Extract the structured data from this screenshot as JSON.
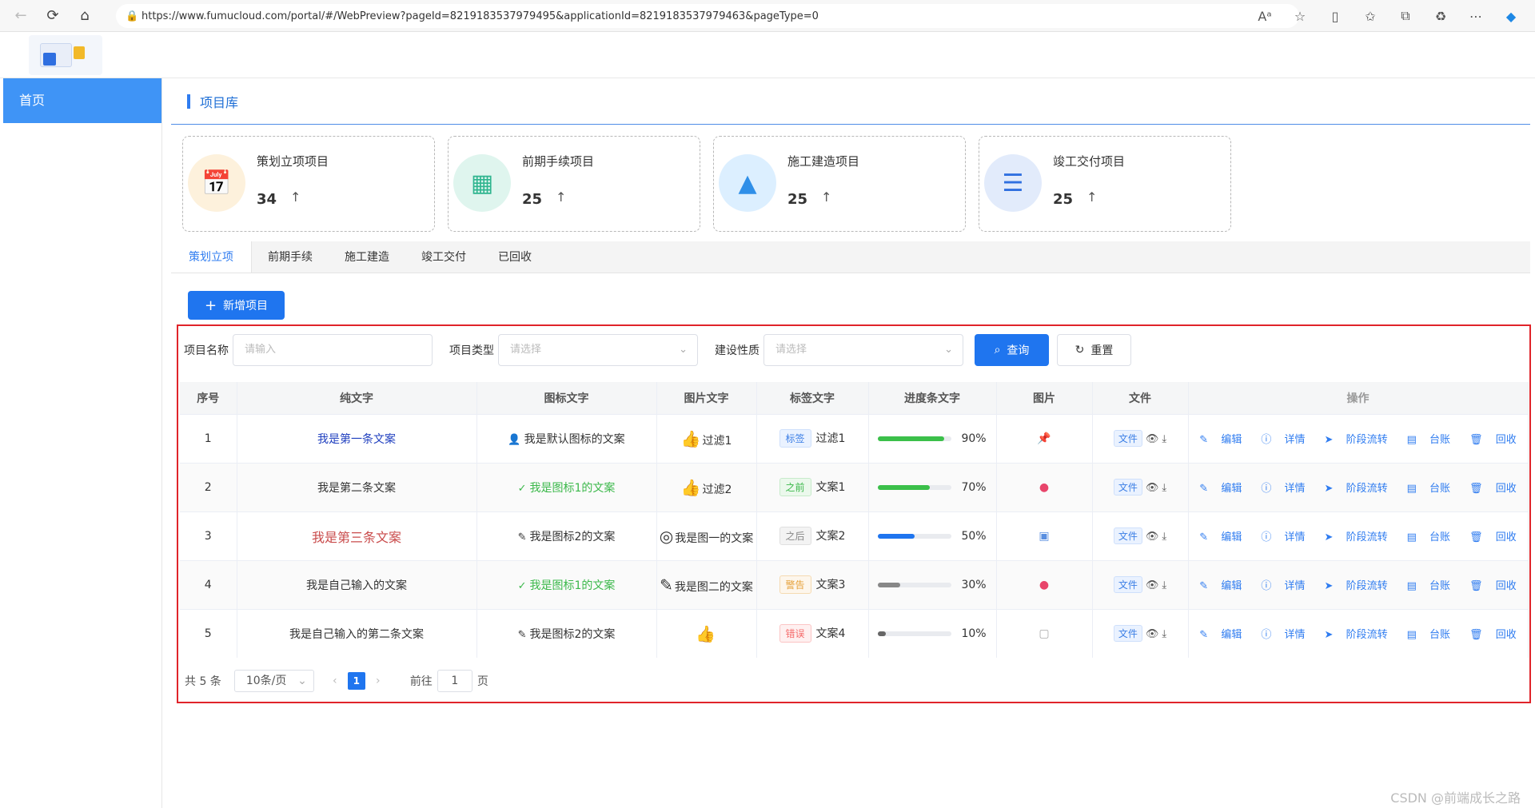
{
  "browser": {
    "url": "https://www.fumucloud.com/portal/#/WebPreview?pageId=8219183537979495&applicationId=8219183537979463&pageType=0",
    "reader_label": "Aᵃ"
  },
  "sidebar": {
    "items": [
      {
        "label": "首页"
      }
    ]
  },
  "section": {
    "title": "项目库"
  },
  "cards": [
    {
      "label": "策划立项项目",
      "count": "34",
      "arrow": "↑",
      "color": "#f5a623",
      "bg": "#fdf1dc"
    },
    {
      "label": "前期手续项目",
      "count": "25",
      "arrow": "↑",
      "color": "#2fb58f",
      "bg": "#dff5ee"
    },
    {
      "label": "施工建造项目",
      "count": "25",
      "arrow": "↑",
      "color": "#2f8fe8",
      "bg": "#dcefff"
    },
    {
      "label": "竣工交付项目",
      "count": "25",
      "arrow": "↑",
      "color": "#2f6fe0",
      "bg": "#e2ebfb"
    }
  ],
  "tabs": [
    "策划立项",
    "前期手续",
    "施工建造",
    "竣工交付",
    "已回收"
  ],
  "add_button": "新增项目",
  "filter": {
    "name_label": "项目名称",
    "name_placeholder": "请输入",
    "type_label": "项目类型",
    "type_placeholder": "请选择",
    "nature_label": "建设性质",
    "nature_placeholder": "请选择",
    "query": "查询",
    "reset": "重置"
  },
  "table": {
    "headers": [
      "序号",
      "纯文字",
      "图标文字",
      "图片文字",
      "标签文字",
      "进度条文字",
      "图片",
      "文件",
      "操作"
    ],
    "rows": [
      {
        "no": "1",
        "text": "我是第一条文案",
        "icon_text": "我是默认图标的文案",
        "img_text": "过滤1",
        "tag": "标签",
        "tag_text": "过滤1",
        "progress": 90,
        "progress_label": "90%",
        "file": "文件"
      },
      {
        "no": "2",
        "text": "我是第二条文案",
        "icon_text": "我是图标1的文案",
        "img_text": "过滤2",
        "tag": "之前",
        "tag_text": "文案1",
        "progress": 70,
        "progress_label": "70%",
        "file": "文件"
      },
      {
        "no": "3",
        "text": "我是第三条文案",
        "icon_text": "我是图标2的文案",
        "img_text": "我是图一的文案",
        "tag": "之后",
        "tag_text": "文案2",
        "progress": 50,
        "progress_label": "50%",
        "file": "文件"
      },
      {
        "no": "4",
        "text": "我是自己输入的文案",
        "icon_text": "我是图标1的文案",
        "img_text": "我是图二的文案",
        "tag": "警告",
        "tag_text": "文案3",
        "progress": 30,
        "progress_label": "30%",
        "file": "文件"
      },
      {
        "no": "5",
        "text": "我是自己输入的第二条文案",
        "icon_text": "我是图标2的文案",
        "img_text": "",
        "tag": "错误",
        "tag_text": "文案4",
        "progress": 10,
        "progress_label": "10%",
        "file": "文件"
      }
    ],
    "ops": [
      "编辑",
      "详情",
      "阶段流转",
      "台账",
      "回收"
    ]
  },
  "pager": {
    "total": "共 5 条",
    "size": "10条/页",
    "current": "1",
    "goto": "前往",
    "goto_value": "1",
    "page_unit": "页"
  },
  "watermark": "CSDN @前端成长之路"
}
